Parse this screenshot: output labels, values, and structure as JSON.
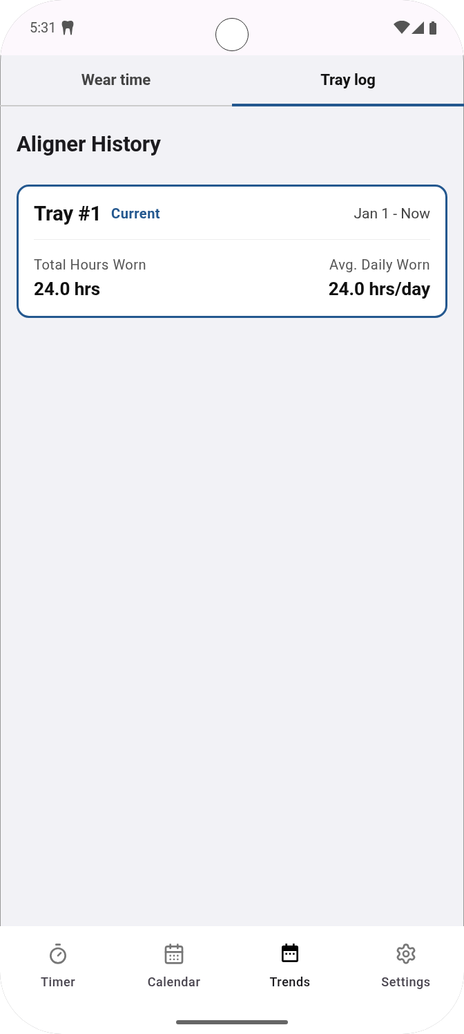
{
  "status_bar": {
    "time": "5:31"
  },
  "tabs": [
    {
      "label": "Wear time",
      "selected": false
    },
    {
      "label": "Tray log",
      "selected": true
    }
  ],
  "section_title": "Aligner History",
  "trays": [
    {
      "name": "Tray #1",
      "badge": "Current",
      "dates": "Jan 1 - Now",
      "selected": true,
      "stats": [
        {
          "label": "Total Hours Worn",
          "value": "24.0 hrs"
        },
        {
          "label": "Avg. Daily Worn",
          "value": "24.0 hrs/day"
        }
      ]
    }
  ],
  "nav": [
    {
      "kind": "timer",
      "label": "Timer",
      "selected": false
    },
    {
      "kind": "calendar",
      "label": "Calendar",
      "selected": false
    },
    {
      "kind": "trends",
      "label": "Trends",
      "selected": true
    },
    {
      "kind": "settings",
      "label": "Settings",
      "selected": false
    }
  ]
}
